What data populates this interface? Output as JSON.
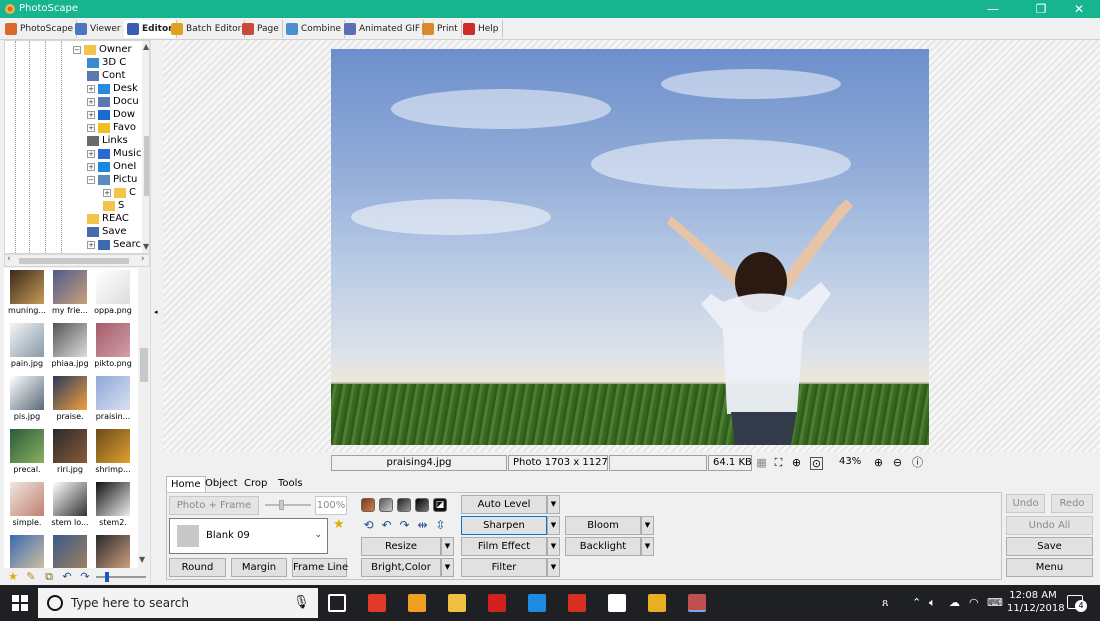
{
  "window": {
    "title": "PhotoScape",
    "controls": {
      "minimize": "—",
      "maximize": "❐",
      "close": "✕"
    }
  },
  "menu_tabs": [
    {
      "label": "PhotoScape",
      "icon": "photoscape-icon",
      "color": "#d9682b"
    },
    {
      "label": "Viewer",
      "icon": "viewer-icon",
      "color": "#4a78c2"
    },
    {
      "label": "Editor",
      "icon": "editor-icon",
      "color": "#3a5fb0",
      "active": true
    },
    {
      "label": "Batch Editor",
      "icon": "batch-editor-icon",
      "color": "#e0a020"
    },
    {
      "label": "Page",
      "icon": "page-icon",
      "color": "#c94a3a"
    },
    {
      "label": "Combine",
      "icon": "combine-icon",
      "color": "#4a90d0"
    },
    {
      "label": "Animated GIF",
      "icon": "animated-gif-icon",
      "color": "#5a6fb8"
    },
    {
      "label": "Print",
      "icon": "print-icon",
      "color": "#d9882b"
    },
    {
      "label": "Help",
      "icon": "help-icon",
      "color": "#d02a2a"
    }
  ],
  "folder_tree": {
    "nodes": [
      {
        "label": "Owner",
        "icon": "folder-icon",
        "pm": "⊟"
      },
      {
        "label": "3D C",
        "icon": "3d-objects-icon",
        "pm": ""
      },
      {
        "label": "Cont",
        "icon": "contacts-icon",
        "pm": ""
      },
      {
        "label": "Desk",
        "icon": "desktop-icon",
        "pm": "+"
      },
      {
        "label": "Docu",
        "icon": "documents-icon",
        "pm": "+"
      },
      {
        "label": "Dow",
        "icon": "downloads-icon",
        "pm": "+"
      },
      {
        "label": "Favo",
        "icon": "favorites-icon",
        "pm": "+"
      },
      {
        "label": "Links",
        "icon": "links-icon",
        "pm": ""
      },
      {
        "label": "Music",
        "icon": "music-icon",
        "pm": "+"
      },
      {
        "label": "OneI",
        "icon": "onedrive-icon",
        "pm": "+"
      },
      {
        "label": "Pictu",
        "icon": "pictures-icon",
        "pm": "−"
      },
      {
        "label": "C",
        "icon": "folder-icon",
        "pm": "+"
      },
      {
        "label": "S",
        "icon": "folder-icon",
        "pm": ""
      },
      {
        "label": "REAC",
        "icon": "folder-icon",
        "pm": ""
      },
      {
        "label": "Save",
        "icon": "saved-games-icon",
        "pm": ""
      },
      {
        "label": "Searc",
        "icon": "searches-icon",
        "pm": "+"
      }
    ]
  },
  "thumbnails": [
    {
      "caption": "muning...",
      "c1": "#3b2a1a",
      "c2": "#c79a5a"
    },
    {
      "caption": "my frie...",
      "c1": "#4f5a8a",
      "c2": "#c9a07a"
    },
    {
      "caption": "oppa.png",
      "c1": "#ffffff",
      "c2": "#dddddd"
    },
    {
      "caption": "pain.jpg",
      "c1": "#f5f5f5",
      "c2": "#8899aa"
    },
    {
      "caption": "phiaa.jpg",
      "c1": "#555555",
      "c2": "#dddddd"
    },
    {
      "caption": "pikto.png",
      "c1": "#a45a6a",
      "c2": "#d2a0a8"
    },
    {
      "caption": "pis.jpg",
      "c1": "#ffffff",
      "c2": "#5a6a7a"
    },
    {
      "caption": "praise.",
      "c1": "#2a3a5a",
      "c2": "#f0a040"
    },
    {
      "caption": "praisin...",
      "c1": "#8fa8d8",
      "c2": "#d8e0f0"
    },
    {
      "caption": "precal.",
      "c1": "#2a5a3a",
      "c2": "#8ab060"
    },
    {
      "caption": "riri.jpg",
      "c1": "#2a2a2a",
      "c2": "#8a5a3a"
    },
    {
      "caption": "shrimp...",
      "c1": "#6a4a1a",
      "c2": "#e0a030"
    },
    {
      "caption": "simple.",
      "c1": "#f0e8e0",
      "c2": "#c08070"
    },
    {
      "caption": "stem lo...",
      "c1": "#ffffff",
      "c2": "#333333"
    },
    {
      "caption": "stem2.",
      "c1": "#111111",
      "c2": "#eeeeee"
    },
    {
      "caption": "",
      "c1": "#3a6ab0",
      "c2": "#d0c0a0"
    },
    {
      "caption": "",
      "c1": "#3a5a8a",
      "c2": "#a08060"
    },
    {
      "caption": "",
      "c1": "#2a2a2a",
      "c2": "#d0a080"
    }
  ],
  "left_tools": [
    {
      "glyph": "★",
      "name": "favorite-star-icon",
      "color": "#e0b000"
    },
    {
      "glyph": "✎",
      "name": "rename-icon",
      "color": "#c08020"
    },
    {
      "glyph": "⧉",
      "name": "copy-icon",
      "color": "#806020"
    },
    {
      "glyph": "↶",
      "name": "rotate-left-icon",
      "color": "#1f4e94"
    },
    {
      "glyph": "↷",
      "name": "rotate-right-icon",
      "color": "#1f4e94"
    }
  ],
  "thumb_size_level": 0.2,
  "status": {
    "filename": "praising4.jpg",
    "dimensions": "Photo 1703 x 1127",
    "extra": "",
    "filesize": "64.1 KB",
    "zoom": "43%"
  },
  "panel": {
    "tabs": [
      "Home",
      "Object",
      "Crop",
      "Tools"
    ],
    "photo_frame": "Photo + Frame",
    "frame_percent": "100%",
    "frame_value": "Blank 09",
    "round": "Round",
    "margin": "Margin",
    "frame_line": "Frame Line",
    "auto_level": "Auto Level",
    "sharpen": "Sharpen",
    "bloom": "Bloom",
    "resize": "Resize",
    "film_effect": "Film Effect",
    "backlight": "Backlight",
    "bright_color": "Bright,Color",
    "filter": "Filter",
    "undo": "Undo",
    "redo": "Redo",
    "undo_all": "Undo All",
    "save": "Save",
    "menu": "Menu"
  },
  "taskbar": {
    "search_placeholder": "Type here to search",
    "time": "12:08 AM",
    "date": "11/12/2018",
    "notifications": "4",
    "apps": [
      {
        "name": "task-view-icon",
        "color": "#ffffff"
      },
      {
        "name": "photobooth-icon",
        "color": "#e23a2a"
      },
      {
        "name": "store-icon",
        "color": "#f0a020"
      },
      {
        "name": "file-explorer-icon",
        "color": "#f0c040"
      },
      {
        "name": "ruby-icon",
        "color": "#d02020"
      },
      {
        "name": "edge-icon",
        "color": "#1e8ae0"
      },
      {
        "name": "acrobat-icon",
        "color": "#d83020"
      },
      {
        "name": "mail-icon",
        "color": "#ffffff"
      },
      {
        "name": "chrome-icon",
        "color": "#e8b020"
      },
      {
        "name": "photoscape-task-icon",
        "color": "#c05050"
      }
    ]
  }
}
